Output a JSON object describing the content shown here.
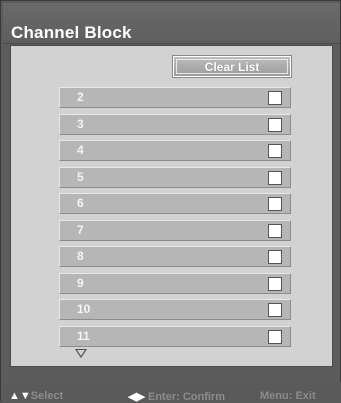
{
  "window": {
    "title": "Channel Block"
  },
  "actions": {
    "clear_list_label": "Clear List"
  },
  "channels": [
    {
      "number": "2",
      "checked": false
    },
    {
      "number": "3",
      "checked": false
    },
    {
      "number": "4",
      "checked": false
    },
    {
      "number": "5",
      "checked": false
    },
    {
      "number": "6",
      "checked": false
    },
    {
      "number": "7",
      "checked": false
    },
    {
      "number": "8",
      "checked": false
    },
    {
      "number": "9",
      "checked": false
    },
    {
      "number": "10",
      "checked": false
    },
    {
      "number": "11",
      "checked": false
    }
  ],
  "footer": {
    "select_glyph": "▲▼",
    "select_label": "Select",
    "confirm_glyph": "◀▶",
    "confirm_label": "Enter: Confirm",
    "exit_label": "Menu: Exit"
  },
  "colors": {
    "background": "#5c5c5c",
    "list_background": "#d2d2d2",
    "row_background": "#b6b6b6",
    "text_light": "#ffffff",
    "footer_text": "#8c8c8c"
  }
}
